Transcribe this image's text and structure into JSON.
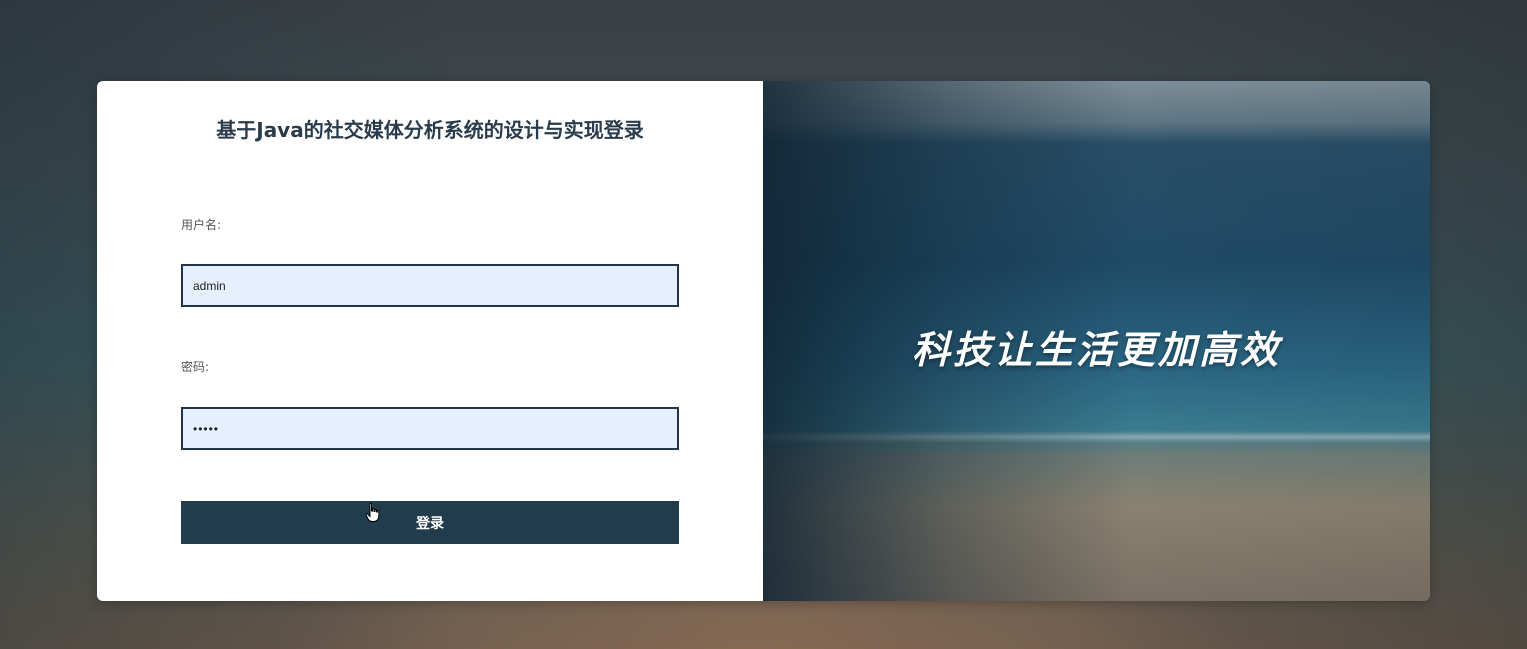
{
  "login": {
    "title": "基于Java的社交媒体分析系统的设计与实现登录",
    "username_label": "用户名:",
    "username_value": "admin",
    "password_label": "密码:",
    "password_value": "admin",
    "login_button": "登录"
  },
  "banner": {
    "slogan": "科技让生活更加高效"
  },
  "colors": {
    "primary": "#213c4c",
    "input_bg": "#e6effd",
    "input_border": "#22354a",
    "card_bg": "#ffffff"
  }
}
